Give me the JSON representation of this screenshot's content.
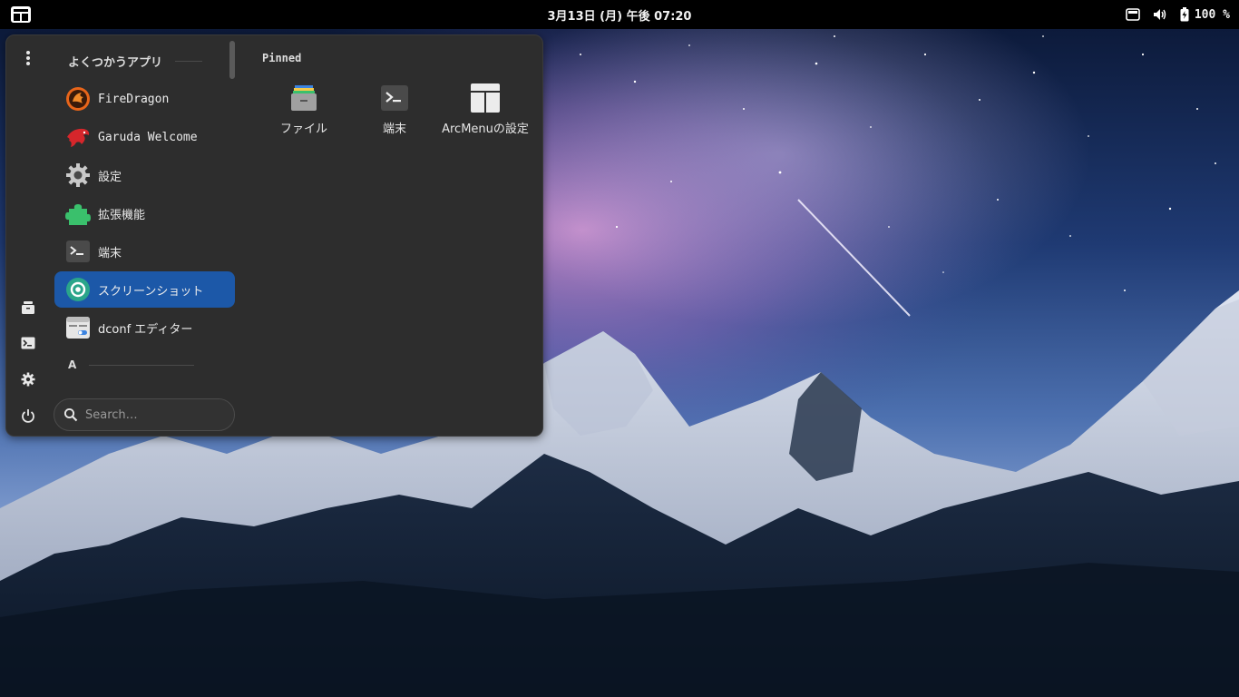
{
  "topbar": {
    "clock": "3月13日 (月) 午後 07:20",
    "battery_percent": "100 %",
    "icons": [
      "activities-menu-icon",
      "display-icon",
      "volume-icon",
      "battery-icon"
    ]
  },
  "arcmenu": {
    "frequent_header": "よくつかうアプリ",
    "apps": [
      {
        "label": "FireDragon",
        "icon": "firedragon-icon"
      },
      {
        "label": "Garuda Welcome",
        "icon": "garuda-eagle-icon"
      },
      {
        "label": "設定",
        "icon": "settings-gear-icon"
      },
      {
        "label": "拡張機能",
        "icon": "puzzle-piece-icon"
      },
      {
        "label": "端末",
        "icon": "terminal-icon"
      },
      {
        "label": "スクリーンショット",
        "icon": "camera-aperture-icon",
        "selected": true
      },
      {
        "label": "dconf エディター",
        "icon": "dconf-editor-icon"
      }
    ],
    "letter_header": "A",
    "search_placeholder": "Search…",
    "pinned_title": "Pinned",
    "pinned": [
      {
        "label": "ファイル",
        "icon": "file-cabinet-icon"
      },
      {
        "label": "端末",
        "icon": "terminal-icon"
      },
      {
        "label": "ArcMenuの設定",
        "icon": "arcmenu-layout-icon"
      }
    ],
    "rail_icons": [
      "kebab-menu-icon",
      "file-cabinet-icon",
      "terminal-icon",
      "gear-icon",
      "power-icon"
    ]
  },
  "colors": {
    "panel_bg": "#2d2d2d",
    "selection": "#1c58a8",
    "topbar_bg": "#000000"
  }
}
